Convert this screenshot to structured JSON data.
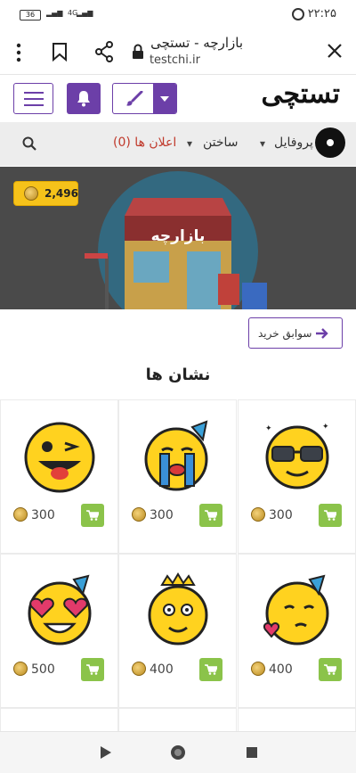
{
  "status": {
    "time": "۲۲:۲۵",
    "battery": "36",
    "network": "4G"
  },
  "browser": {
    "tab_title": "بازارچه - تستچی",
    "domain": "testchi.ir"
  },
  "site": {
    "logo": "تستچی"
  },
  "nav": {
    "profile": "پروفایل",
    "build": "ساختن",
    "notices": "اعلان ها (0)"
  },
  "banner": {
    "title": "بازارچه",
    "coins": "2,496"
  },
  "history_button": "سوابق خرید",
  "section_title": "نشان ها",
  "badges": [
    {
      "name": "cool-sunglasses-emoji",
      "price": "300"
    },
    {
      "name": "crying-party-emoji",
      "price": "300"
    },
    {
      "name": "winking-tongue-emoji",
      "price": "300"
    },
    {
      "name": "blowing-kiss-party-emoji",
      "price": "400"
    },
    {
      "name": "crowned-old-emoji",
      "price": "400"
    },
    {
      "name": "heart-eyes-party-emoji",
      "price": "500"
    }
  ],
  "colors": {
    "accent": "#6c3fa8",
    "coin": "#f6c21a",
    "cart": "#8bc34a",
    "notices": "#c0392b"
  }
}
